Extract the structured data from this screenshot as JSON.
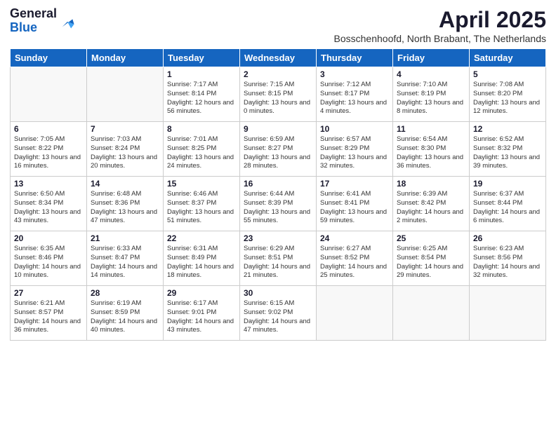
{
  "logo": {
    "general": "General",
    "blue": "Blue"
  },
  "title": "April 2025",
  "subtitle": "Bosschenhoofd, North Brabant, The Netherlands",
  "headers": [
    "Sunday",
    "Monday",
    "Tuesday",
    "Wednesday",
    "Thursday",
    "Friday",
    "Saturday"
  ],
  "weeks": [
    [
      {
        "day": "",
        "info": ""
      },
      {
        "day": "",
        "info": ""
      },
      {
        "day": "1",
        "info": "Sunrise: 7:17 AM\nSunset: 8:14 PM\nDaylight: 12 hours and 56 minutes."
      },
      {
        "day": "2",
        "info": "Sunrise: 7:15 AM\nSunset: 8:15 PM\nDaylight: 13 hours and 0 minutes."
      },
      {
        "day": "3",
        "info": "Sunrise: 7:12 AM\nSunset: 8:17 PM\nDaylight: 13 hours and 4 minutes."
      },
      {
        "day": "4",
        "info": "Sunrise: 7:10 AM\nSunset: 8:19 PM\nDaylight: 13 hours and 8 minutes."
      },
      {
        "day": "5",
        "info": "Sunrise: 7:08 AM\nSunset: 8:20 PM\nDaylight: 13 hours and 12 minutes."
      }
    ],
    [
      {
        "day": "6",
        "info": "Sunrise: 7:05 AM\nSunset: 8:22 PM\nDaylight: 13 hours and 16 minutes."
      },
      {
        "day": "7",
        "info": "Sunrise: 7:03 AM\nSunset: 8:24 PM\nDaylight: 13 hours and 20 minutes."
      },
      {
        "day": "8",
        "info": "Sunrise: 7:01 AM\nSunset: 8:25 PM\nDaylight: 13 hours and 24 minutes."
      },
      {
        "day": "9",
        "info": "Sunrise: 6:59 AM\nSunset: 8:27 PM\nDaylight: 13 hours and 28 minutes."
      },
      {
        "day": "10",
        "info": "Sunrise: 6:57 AM\nSunset: 8:29 PM\nDaylight: 13 hours and 32 minutes."
      },
      {
        "day": "11",
        "info": "Sunrise: 6:54 AM\nSunset: 8:30 PM\nDaylight: 13 hours and 36 minutes."
      },
      {
        "day": "12",
        "info": "Sunrise: 6:52 AM\nSunset: 8:32 PM\nDaylight: 13 hours and 39 minutes."
      }
    ],
    [
      {
        "day": "13",
        "info": "Sunrise: 6:50 AM\nSunset: 8:34 PM\nDaylight: 13 hours and 43 minutes."
      },
      {
        "day": "14",
        "info": "Sunrise: 6:48 AM\nSunset: 8:36 PM\nDaylight: 13 hours and 47 minutes."
      },
      {
        "day": "15",
        "info": "Sunrise: 6:46 AM\nSunset: 8:37 PM\nDaylight: 13 hours and 51 minutes."
      },
      {
        "day": "16",
        "info": "Sunrise: 6:44 AM\nSunset: 8:39 PM\nDaylight: 13 hours and 55 minutes."
      },
      {
        "day": "17",
        "info": "Sunrise: 6:41 AM\nSunset: 8:41 PM\nDaylight: 13 hours and 59 minutes."
      },
      {
        "day": "18",
        "info": "Sunrise: 6:39 AM\nSunset: 8:42 PM\nDaylight: 14 hours and 2 minutes."
      },
      {
        "day": "19",
        "info": "Sunrise: 6:37 AM\nSunset: 8:44 PM\nDaylight: 14 hours and 6 minutes."
      }
    ],
    [
      {
        "day": "20",
        "info": "Sunrise: 6:35 AM\nSunset: 8:46 PM\nDaylight: 14 hours and 10 minutes."
      },
      {
        "day": "21",
        "info": "Sunrise: 6:33 AM\nSunset: 8:47 PM\nDaylight: 14 hours and 14 minutes."
      },
      {
        "day": "22",
        "info": "Sunrise: 6:31 AM\nSunset: 8:49 PM\nDaylight: 14 hours and 18 minutes."
      },
      {
        "day": "23",
        "info": "Sunrise: 6:29 AM\nSunset: 8:51 PM\nDaylight: 14 hours and 21 minutes."
      },
      {
        "day": "24",
        "info": "Sunrise: 6:27 AM\nSunset: 8:52 PM\nDaylight: 14 hours and 25 minutes."
      },
      {
        "day": "25",
        "info": "Sunrise: 6:25 AM\nSunset: 8:54 PM\nDaylight: 14 hours and 29 minutes."
      },
      {
        "day": "26",
        "info": "Sunrise: 6:23 AM\nSunset: 8:56 PM\nDaylight: 14 hours and 32 minutes."
      }
    ],
    [
      {
        "day": "27",
        "info": "Sunrise: 6:21 AM\nSunset: 8:57 PM\nDaylight: 14 hours and 36 minutes."
      },
      {
        "day": "28",
        "info": "Sunrise: 6:19 AM\nSunset: 8:59 PM\nDaylight: 14 hours and 40 minutes."
      },
      {
        "day": "29",
        "info": "Sunrise: 6:17 AM\nSunset: 9:01 PM\nDaylight: 14 hours and 43 minutes."
      },
      {
        "day": "30",
        "info": "Sunrise: 6:15 AM\nSunset: 9:02 PM\nDaylight: 14 hours and 47 minutes."
      },
      {
        "day": "",
        "info": ""
      },
      {
        "day": "",
        "info": ""
      },
      {
        "day": "",
        "info": ""
      }
    ]
  ],
  "colors": {
    "header_bg": "#1565c0",
    "header_text": "#ffffff",
    "border": "#cccccc"
  }
}
